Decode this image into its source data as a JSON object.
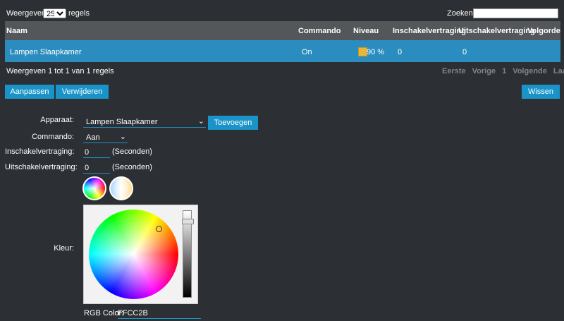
{
  "top": {
    "show_label": "Weergeven",
    "show_value": "25",
    "rows_label": "regels",
    "search_label": "Zoeken :",
    "search_value": ""
  },
  "table": {
    "headers": [
      "Naam",
      "Commando",
      "Niveau",
      "Inschakelvertraging",
      "Uitschakelvertraging",
      "Volgorde"
    ],
    "rows": [
      {
        "name": "Lampen Slaapkamer",
        "command": "On",
        "level": "90 %",
        "level_color": "#e8b63a",
        "on_delay": "0",
        "off_delay": "0",
        "order": ""
      }
    ]
  },
  "info": {
    "text": "Weergeven 1 tot 1 van 1 regels"
  },
  "pager": {
    "first": "Eerste",
    "prev": "Vorige",
    "page": "1",
    "next": "Volgende",
    "last": "Laatste"
  },
  "actions": {
    "edit": "Aanpassen",
    "delete": "Verwijderen",
    "clear": "Wissen"
  },
  "form": {
    "device_label": "Apparaat:",
    "device_value": "Lampen Slaapkamer",
    "add_button": "Toevoegen",
    "command_label": "Commando:",
    "command_value": "Aan",
    "on_delay_label": "Inschakelvertraging:",
    "on_delay_value": "0",
    "on_delay_unit": "(Seconden)",
    "off_delay_label": "Uitschakelvertraging:",
    "off_delay_value": "0",
    "off_delay_unit": "(Seconden)",
    "color_label": "Kleur:",
    "rgb_label": "RGB Color:",
    "rgb_value": "FFCC2B"
  },
  "colors": {
    "accent": "#1a94c8",
    "row_selected": "#2b8dbf",
    "header_bg": "#54575a",
    "background": "#2c2f33"
  }
}
